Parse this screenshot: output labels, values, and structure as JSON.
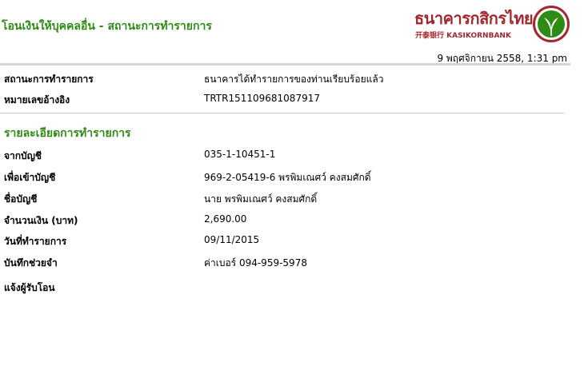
{
  "header": {
    "title": "โอนเงินให้บุคคลอื่น - สถานะการทำรายการ",
    "datetime": "9 พฤศจิกายน 2558, 1:31 pm"
  },
  "brand": {
    "name_th": "ธนาคารกสิกรไทย",
    "name_en": "开泰银行 KASIKORNBANK",
    "color_primary": "#a3272e",
    "color_accent": "#2e8b14",
    "emblem_icon": "kbank-leaf-icon"
  },
  "status": {
    "label": "สถานะการทำรายการ",
    "value": "ธนาคารได้ทำรายการของท่านเรียบร้อยแล้ว"
  },
  "reference": {
    "label": "หมายเลขอ้างอิง",
    "value": "TRTR151109681087917"
  },
  "details": {
    "title": "รายละเอียดการทำรายการ",
    "from_account": {
      "label": "จากบัญชี",
      "value": "035-1-10451-1"
    },
    "to_account": {
      "label": "เพื่อเข้าบัญชี",
      "value": "969-2-05419-6 พรพิมเณศว์ คงสมศักดิ์"
    },
    "account_name": {
      "label": "ชื่อบัญชี",
      "value": "นาย พรพิมเณศว์ คงสมศักดิ์"
    },
    "amount": {
      "label": "จำนวนเงิน (บาท)",
      "value": "2,690.00"
    },
    "transaction_date": {
      "label": "วันที่ทำรายการ",
      "value": "09/11/2015"
    },
    "memo": {
      "label": "บันทึกช่วยจำ",
      "value": "ค่าเบอร์ 094-959-5978"
    },
    "notify_recipient": {
      "label": "แจ้งผู้รับโอน",
      "value": ""
    }
  }
}
